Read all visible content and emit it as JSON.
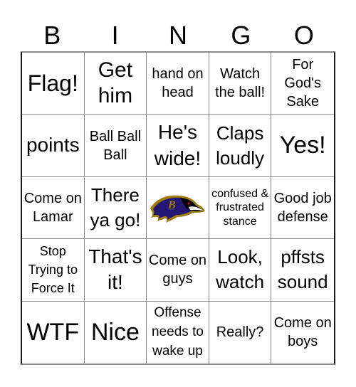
{
  "header": {
    "letters": [
      "B",
      "I",
      "N",
      "G",
      "O"
    ]
  },
  "cells": [
    "Flag!",
    "Get him",
    "hand on head",
    "Watch the ball!",
    "For God's Sake",
    "points",
    "Ball Ball Ball",
    "He's wide!",
    "Claps loudly",
    "Yes!",
    "Come on Lamar",
    "There ya go!",
    "",
    "confused & frustrated stance",
    "Good job defense",
    "Stop Trying to Force It",
    "That's it!",
    "Come on guys",
    "Look, watch",
    "pffsts sound",
    "WTF",
    "Nice",
    "Offense needs to wake up",
    "Really?",
    "Come on boys"
  ],
  "free_space": {
    "icon": "ravens-logo-icon",
    "colors": {
      "purple": "#241773",
      "gold": "#9E7C0C",
      "black": "#000000",
      "red": "#C60C30"
    }
  }
}
